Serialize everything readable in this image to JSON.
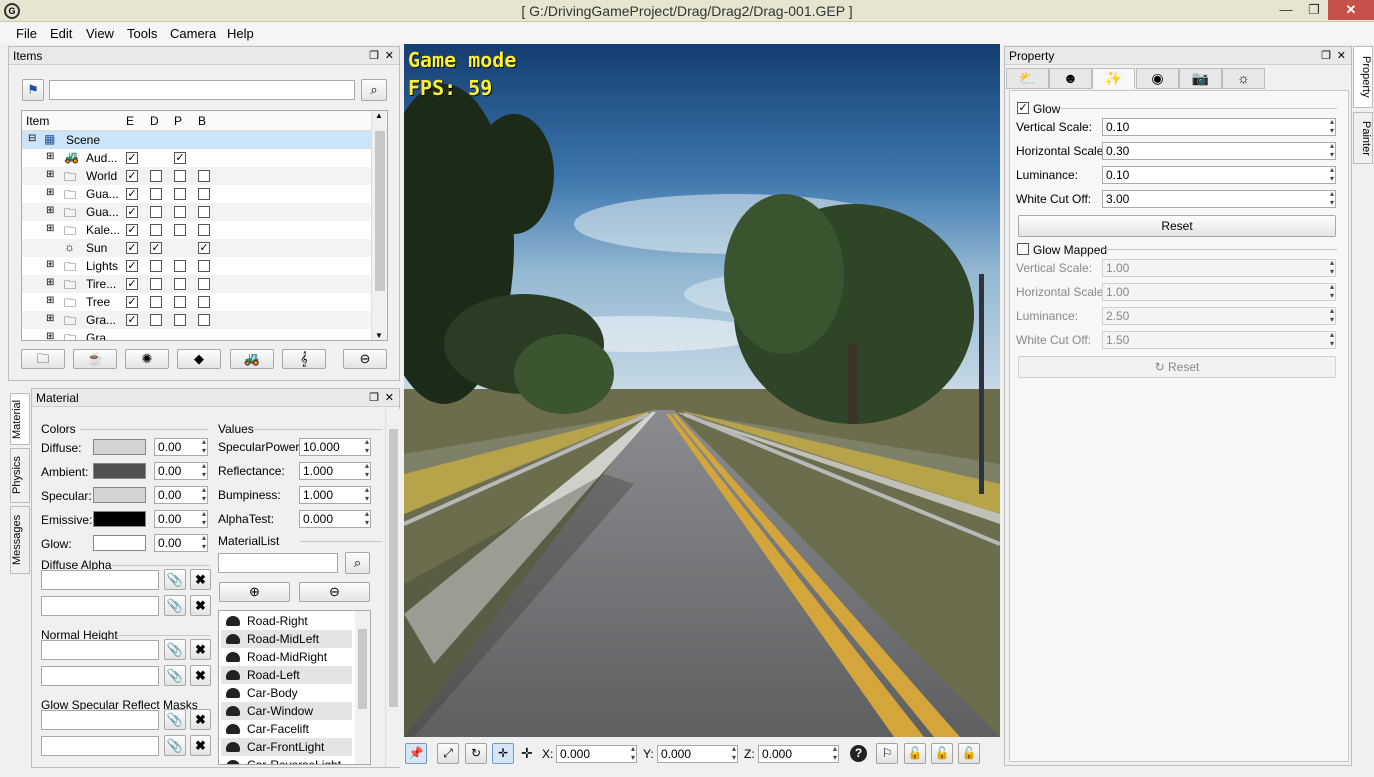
{
  "window": {
    "title": "[ G:/DrivingGameProject/Drag/Drag2/Drag-001.GEP ]",
    "minimize": "—",
    "maximize": "❐",
    "close": "✕"
  },
  "menu": [
    "File",
    "Edit",
    "View",
    "Tools",
    "Camera",
    "Help"
  ],
  "items_panel": {
    "title": "Items",
    "search_value": "",
    "columns": [
      "Item",
      "E",
      "D",
      "P",
      "B"
    ],
    "rows": [
      {
        "label": "Scene",
        "e": null,
        "d": null,
        "p": null,
        "b": null
      },
      {
        "label": "Aud...",
        "e": true,
        "d": null,
        "p": true,
        "b": null
      },
      {
        "label": "World",
        "e": true,
        "d": false,
        "p": false,
        "b": false
      },
      {
        "label": "Gua...",
        "e": true,
        "d": false,
        "p": false,
        "b": false
      },
      {
        "label": "Gua...",
        "e": true,
        "d": false,
        "p": false,
        "b": false
      },
      {
        "label": "Kale...",
        "e": true,
        "d": false,
        "p": false,
        "b": false
      },
      {
        "label": "Sun",
        "e": true,
        "d": true,
        "p": null,
        "b": true
      },
      {
        "label": "Lights",
        "e": true,
        "d": false,
        "p": false,
        "b": false
      },
      {
        "label": "Tire...",
        "e": true,
        "d": false,
        "p": false,
        "b": false
      },
      {
        "label": "Tree",
        "e": true,
        "d": false,
        "p": false,
        "b": false
      },
      {
        "label": "Gra...",
        "e": true,
        "d": false,
        "p": false,
        "b": false
      },
      {
        "label": "Gra...",
        "e": null,
        "d": null,
        "p": null,
        "b": null
      }
    ],
    "toolbar_icons": [
      "folder-icon",
      "teapot-icon",
      "light-icon",
      "diamond-icon",
      "tractor-icon",
      "music-icon",
      "remove-icon"
    ]
  },
  "material_panel": {
    "title": "Material",
    "side_tabs": [
      "Material",
      "Physics",
      "Messages"
    ],
    "colors_group": "Colors",
    "colors": [
      {
        "label": "Diffuse:",
        "swatch": "#d4d4d4",
        "value": "0.00"
      },
      {
        "label": "Ambient:",
        "swatch": "#505050",
        "value": "0.00"
      },
      {
        "label": "Specular:",
        "swatch": "#d4d4d4",
        "value": "0.00"
      },
      {
        "label": "Emissive:",
        "swatch": "#000000",
        "value": "0.00"
      },
      {
        "label": "Glow:",
        "swatch": "#ffffff",
        "value": "0.00"
      }
    ],
    "values_group": "Values",
    "values": [
      {
        "label": "SpecularPower:",
        "value": "10.000"
      },
      {
        "label": "Reflectance:",
        "value": "1.000"
      },
      {
        "label": "Bumpiness:",
        "value": "1.000"
      },
      {
        "label": "AlphaTest:",
        "value": "0.000"
      }
    ],
    "diffuse_alpha": "Diffuse Alpha",
    "normal_height": "Normal Height",
    "glow_masks": "Glow Specular Reflect Masks",
    "material_list_label": "MaterialList",
    "material_list": [
      "Road-Right",
      "Road-MidLeft",
      "Road-MidRight",
      "Road-Left",
      "Car-Body",
      "Car-Window",
      "Car-Facelift",
      "Car-FrontLight",
      "Car-ReverseLight"
    ]
  },
  "viewport": {
    "mode": "Game mode",
    "fps": "FPS: 59",
    "coords": {
      "x_label": "X:",
      "x": "0.000",
      "y_label": "Y:",
      "y": "0.000",
      "z_label": "Z:",
      "z": "0.000"
    }
  },
  "property_panel": {
    "title": "Property",
    "side_tabs": [
      "Property",
      "Painter"
    ],
    "glow_label": "Glow",
    "glow_checked": true,
    "glow_fields": [
      {
        "label": "Vertical Scale:",
        "value": "0.10"
      },
      {
        "label": "Horizontal Scale:",
        "value": "0.30"
      },
      {
        "label": "Luminance:",
        "value": "0.10"
      },
      {
        "label": "White Cut Off:",
        "value": "3.00"
      }
    ],
    "reset_label": "Reset",
    "glow_mapped_label": "Glow Mapped",
    "glow_mapped_checked": false,
    "mapped_fields": [
      {
        "label": "Vertical Scale:",
        "value": "1.00"
      },
      {
        "label": "Horizontal Scale:",
        "value": "1.00"
      },
      {
        "label": "Luminance:",
        "value": "2.50"
      },
      {
        "label": "White Cut Off:",
        "value": "1.50"
      }
    ],
    "reset2_label": "Reset"
  }
}
